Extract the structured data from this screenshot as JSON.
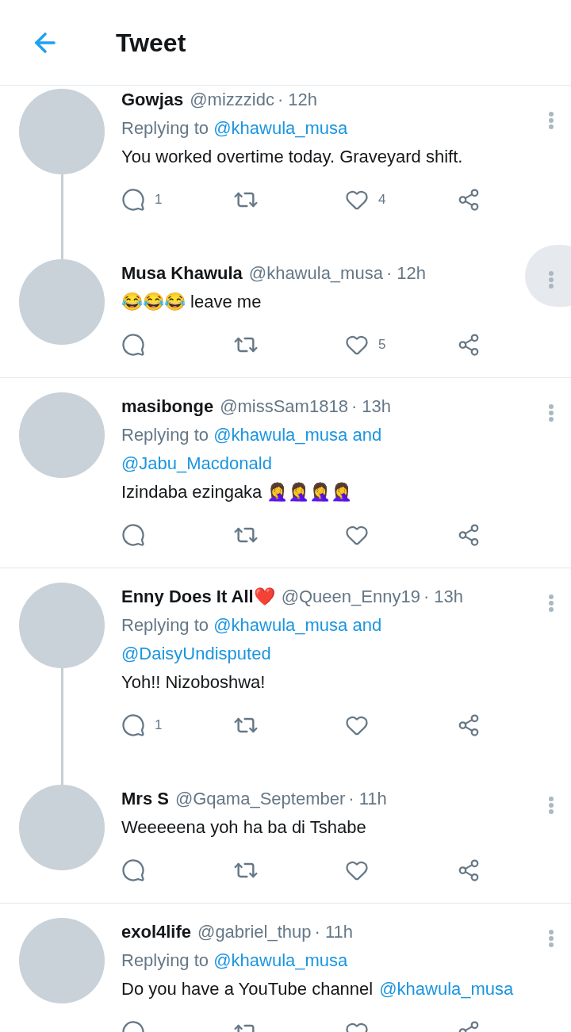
{
  "header": {
    "title": "Tweet"
  },
  "threads": [
    {
      "tweets": [
        {
          "name": "Gowjas",
          "handle": "@mizzzidc",
          "time": "· 12h",
          "replying": {
            "label": "Replying to",
            "handles": [
              "@khawula_musa"
            ]
          },
          "text": "You worked overtime today. Graveyard shift.",
          "replies": "1",
          "likes": "4",
          "menu_pressed": false
        },
        {
          "name": "Musa Khawula",
          "handle": "@khawula_musa",
          "time": "· 12h",
          "text": "😂😂😂 leave me",
          "likes": "5",
          "menu_pressed": true
        }
      ]
    },
    {
      "tweets": [
        {
          "name": "masibonge",
          "handle": "@missSam1818",
          "time": "· 13h",
          "replying": {
            "label": "Replying to",
            "handles": [
              "@khawula_musa",
              "@Jabu_Macdonald"
            ],
            "joiner": "and"
          },
          "text": "Izindaba ezingaka 🤦‍♀️🤦‍♀️🤦‍♀️🤦‍♀️",
          "menu_pressed": false
        }
      ]
    },
    {
      "tweets": [
        {
          "name": "Enny Does It All❤️",
          "handle": "@Queen_Enny19",
          "time": "· 13h",
          "replying": {
            "label": "Replying to",
            "handles": [
              "@khawula_musa",
              "@DaisyUndisputed"
            ],
            "joiner": "and"
          },
          "text": "Yoh!! Nizoboshwa!",
          "replies": "1",
          "menu_pressed": false
        },
        {
          "name": "Mrs S",
          "handle": "@Gqama_September",
          "time": "· 11h",
          "text": "Weeeeena yoh ha ba di Tshabe",
          "menu_pressed": false
        }
      ]
    },
    {
      "tweets": [
        {
          "name": "exol4life",
          "handle": "@gabriel_thup",
          "time": "· 11h",
          "replying": {
            "label": "Replying to",
            "handles": [
              "@khawula_musa"
            ]
          },
          "text": "Do you have a YouTube channel",
          "mention": "@khawula_musa",
          "menu_pressed": false
        }
      ]
    }
  ]
}
